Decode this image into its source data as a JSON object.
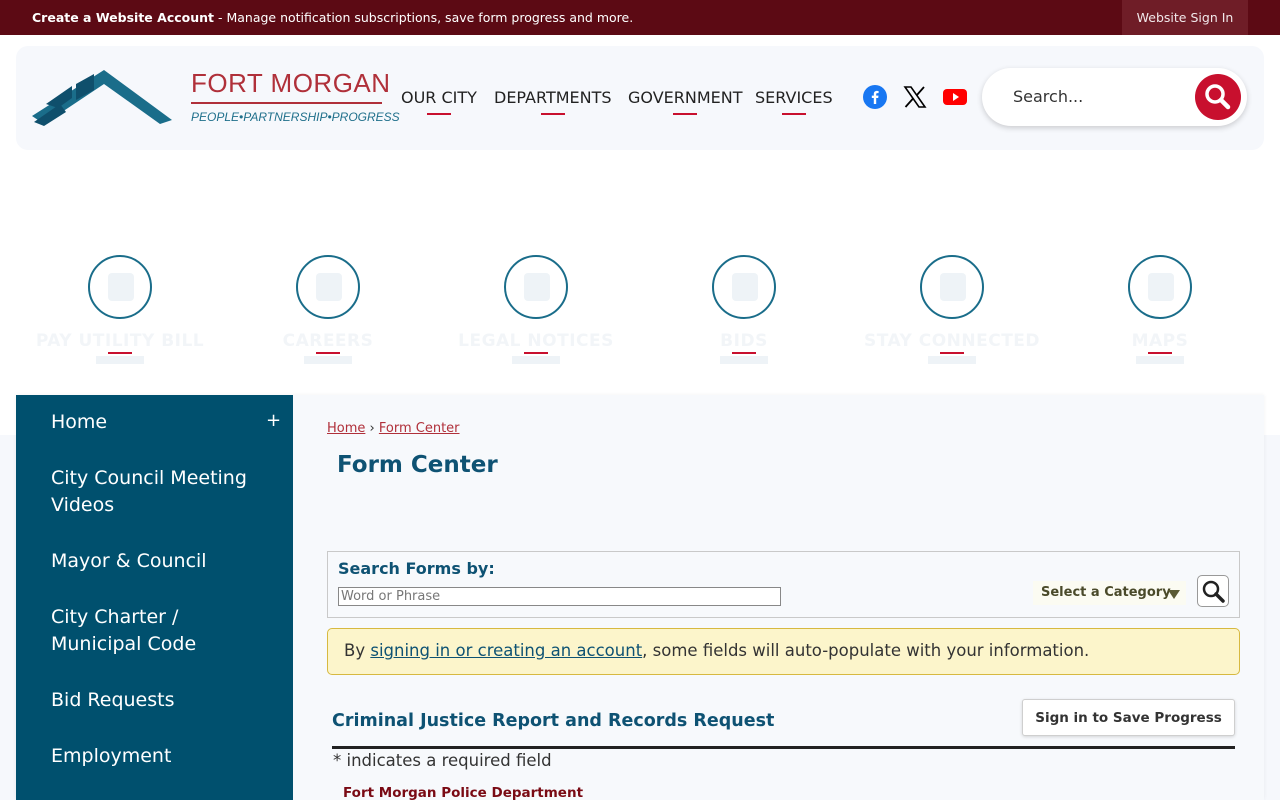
{
  "topbar": {
    "create_account_label": "Create a Website Account",
    "create_account_desc": " - Manage notification subscriptions, save form progress and more.",
    "signin_label": "Website Sign In"
  },
  "logo": {
    "title": "FORT MORGAN",
    "tagline": "PEOPLE•PARTNERSHIP•PROGRESS"
  },
  "nav": {
    "items": [
      "OUR CITY",
      "DEPARTMENTS",
      "GOVERNMENT",
      "SERVICES"
    ]
  },
  "social": {
    "icons": [
      "facebook-icon",
      "x-twitter-icon",
      "youtube-icon"
    ],
    "colors": {
      "facebook": "#1877f2",
      "x": "#000000",
      "youtube": "#ff0000"
    }
  },
  "search": {
    "placeholder": "Search..."
  },
  "quick_links": [
    {
      "label": "PAY UTILITY BILL",
      "icon": "wallet-icon"
    },
    {
      "label": "CAREERS",
      "icon": "briefcase-icon"
    },
    {
      "label": "LEGAL NOTICES",
      "icon": "document-icon"
    },
    {
      "label": "BIDS",
      "icon": "envelope-icon"
    },
    {
      "label": "STAY CONNECTED",
      "icon": "calendar-icon"
    },
    {
      "label": "MAPS",
      "icon": "map-icon"
    }
  ],
  "sidebar": {
    "items": [
      {
        "label": "Home"
      },
      {
        "label": "City Council Meeting Videos"
      },
      {
        "label": "Mayor & Council"
      },
      {
        "label": "City Charter / Municipal Code"
      },
      {
        "label": "Bid Requests"
      },
      {
        "label": "Employment"
      }
    ],
    "expand_symbol": "+"
  },
  "breadcrumb": {
    "home": "Home",
    "separator": "›",
    "current": "Form Center"
  },
  "page": {
    "title": "Form Center"
  },
  "form_search": {
    "label": "Search Forms by:",
    "input_placeholder": "Word or Phrase",
    "category_label": "Select a Category"
  },
  "notice": {
    "prefix": "By ",
    "link": "signing in or creating an account",
    "suffix": ", some fields will auto-populate with your information."
  },
  "form": {
    "title": "Criminal Justice Report and Records Request",
    "save_button": "Sign in to Save Progress",
    "required_note": "* indicates a required field",
    "department": "Fort Morgan Police Department"
  },
  "colors": {
    "topbar": "#5c0a14",
    "accent_red": "#c8102e",
    "brand_teal": "#00506e",
    "heading_blue": "#0e5273",
    "logo_red": "#b0303a"
  }
}
